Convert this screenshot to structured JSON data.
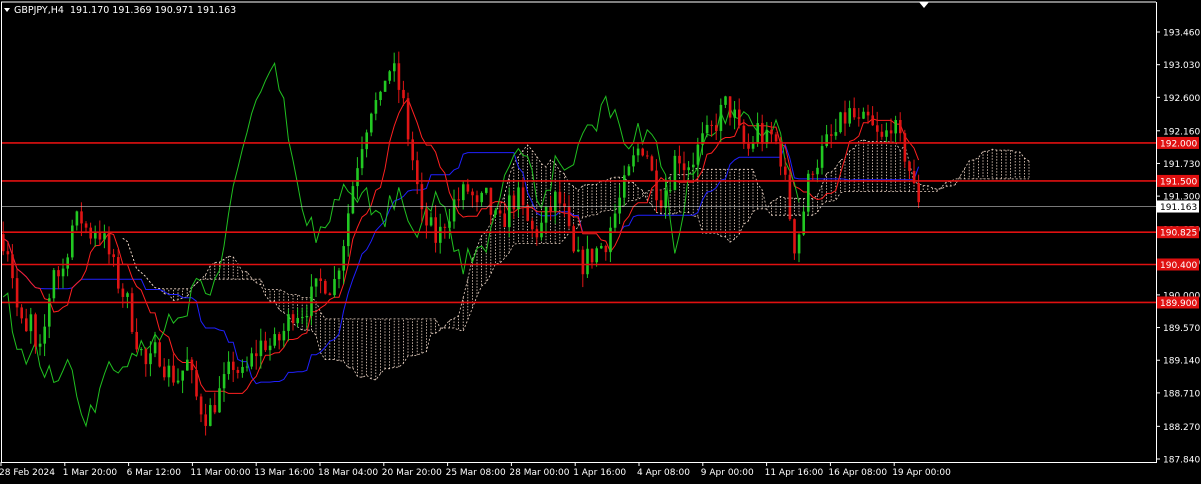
{
  "header": {
    "symbol": "GBPJPY,H4",
    "ohlc": "191.170 191.369 190.971 191.163"
  },
  "colors": {
    "background": "#000000",
    "bull_candle": "#22c822",
    "bear_candle": "#e01414",
    "level_line": "#e01010",
    "tenkan": "#ff2020",
    "kijun": "#2020ff",
    "chikou": "#20c020",
    "cloud": "#f0d8c8",
    "axis": "#ffffff"
  },
  "chart_data": {
    "type": "candlestick",
    "symbol": "GBPJPY",
    "timeframe": "H4",
    "ylim": [
      187.84,
      193.46
    ],
    "y_ticks": [
      "193.460",
      "193.030",
      "192.600",
      "192.160",
      "191.730",
      "191.300",
      "190.870",
      "190.430",
      "190.000",
      "189.570",
      "189.140",
      "188.710",
      "188.270",
      "187.840"
    ],
    "x_ticks": [
      "28 Feb 2024",
      "1 Mar 20:00",
      "6 Mar 12:00",
      "11 Mar 00:00",
      "13 Mar 16:00",
      "18 Mar 04:00",
      "20 Mar 20:00",
      "25 Mar 08:00",
      "28 Mar 00:00",
      "1 Apr 16:00",
      "4 Apr 08:00",
      "9 Apr 00:00",
      "11 Apr 16:00",
      "16 Apr 08:00",
      "19 Apr 00:00"
    ],
    "horizontal_levels": [
      {
        "label": "192.000",
        "value": 192.0
      },
      {
        "label": "191.500",
        "value": 191.5
      },
      {
        "label": "190.825",
        "value": 190.825
      },
      {
        "label": "190.400",
        "value": 190.4
      },
      {
        "label": "189.900",
        "value": 189.9
      }
    ],
    "current_price": {
      "label": "191.163",
      "value": 191.163
    },
    "price_path": [
      [
        0,
        190.8
      ],
      [
        8,
        190.6
      ],
      [
        16,
        189.8
      ],
      [
        24,
        189.4
      ],
      [
        30,
        189.7
      ],
      [
        36,
        189.0
      ],
      [
        44,
        189.6
      ],
      [
        52,
        190.4
      ],
      [
        60,
        190.2
      ],
      [
        70,
        190.9
      ],
      [
        80,
        191.0
      ],
      [
        88,
        190.8
      ],
      [
        96,
        190.9
      ],
      [
        106,
        190.6
      ],
      [
        116,
        190.2
      ],
      [
        126,
        189.9
      ],
      [
        136,
        189.4
      ],
      [
        146,
        189.0
      ],
      [
        156,
        189.3
      ],
      [
        166,
        189.0
      ],
      [
        176,
        188.9
      ],
      [
        186,
        189.1
      ],
      [
        196,
        188.6
      ],
      [
        206,
        188.4
      ],
      [
        214,
        188.6
      ],
      [
        222,
        188.8
      ],
      [
        232,
        189.1
      ],
      [
        242,
        188.9
      ],
      [
        252,
        189.2
      ],
      [
        262,
        189.4
      ],
      [
        272,
        189.3
      ],
      [
        282,
        189.5
      ],
      [
        292,
        189.8
      ],
      [
        302,
        189.8
      ],
      [
        312,
        190.0
      ],
      [
        322,
        190.2
      ],
      [
        332,
        190.1
      ],
      [
        342,
        190.7
      ],
      [
        352,
        191.5
      ],
      [
        360,
        192.0
      ],
      [
        366,
        192.3
      ],
      [
        372,
        192.6
      ],
      [
        378,
        192.4
      ],
      [
        384,
        192.9
      ],
      [
        390,
        193.0
      ],
      [
        396,
        192.8
      ],
      [
        402,
        192.5
      ],
      [
        408,
        192.0
      ],
      [
        414,
        191.6
      ],
      [
        420,
        191.0
      ],
      [
        428,
        190.9
      ],
      [
        436,
        190.7
      ],
      [
        444,
        191.0
      ],
      [
        452,
        191.2
      ],
      [
        460,
        191.3
      ],
      [
        468,
        191.4
      ],
      [
        476,
        191.1
      ],
      [
        484,
        191.3
      ],
      [
        492,
        191.0
      ],
      [
        500,
        190.9
      ],
      [
        508,
        191.2
      ],
      [
        516,
        191.3
      ],
      [
        524,
        191.0
      ],
      [
        532,
        190.8
      ],
      [
        540,
        190.9
      ],
      [
        548,
        191.1
      ],
      [
        556,
        191.3
      ],
      [
        564,
        191.0
      ],
      [
        572,
        190.5
      ],
      [
        580,
        190.4
      ],
      [
        588,
        190.5
      ],
      [
        596,
        190.6
      ],
      [
        604,
        190.7
      ],
      [
        612,
        191.0
      ],
      [
        620,
        191.3
      ],
      [
        628,
        191.6
      ],
      [
        636,
        191.9
      ],
      [
        644,
        192.0
      ],
      [
        652,
        191.5
      ],
      [
        660,
        191.3
      ],
      [
        668,
        191.5
      ],
      [
        676,
        191.9
      ],
      [
        684,
        191.7
      ],
      [
        692,
        191.8
      ],
      [
        700,
        192.0
      ],
      [
        708,
        192.1
      ],
      [
        716,
        192.3
      ],
      [
        724,
        192.5
      ],
      [
        732,
        192.4
      ],
      [
        740,
        192.0
      ],
      [
        748,
        191.9
      ],
      [
        756,
        192.2
      ],
      [
        764,
        192.0
      ],
      [
        772,
        192.1
      ],
      [
        780,
        191.8
      ],
      [
        788,
        191.1
      ],
      [
        794,
        190.6
      ],
      [
        802,
        191.1
      ],
      [
        810,
        191.7
      ],
      [
        818,
        191.8
      ],
      [
        826,
        192.0
      ],
      [
        834,
        192.1
      ],
      [
        842,
        192.3
      ],
      [
        850,
        192.4
      ],
      [
        858,
        192.2
      ],
      [
        866,
        192.3
      ],
      [
        874,
        192.1
      ],
      [
        882,
        192.0
      ],
      [
        890,
        192.3
      ],
      [
        898,
        192.0
      ],
      [
        906,
        191.8
      ],
      [
        912,
        191.4
      ],
      [
        918,
        191.2
      ],
      [
        922,
        191.163
      ]
    ]
  }
}
